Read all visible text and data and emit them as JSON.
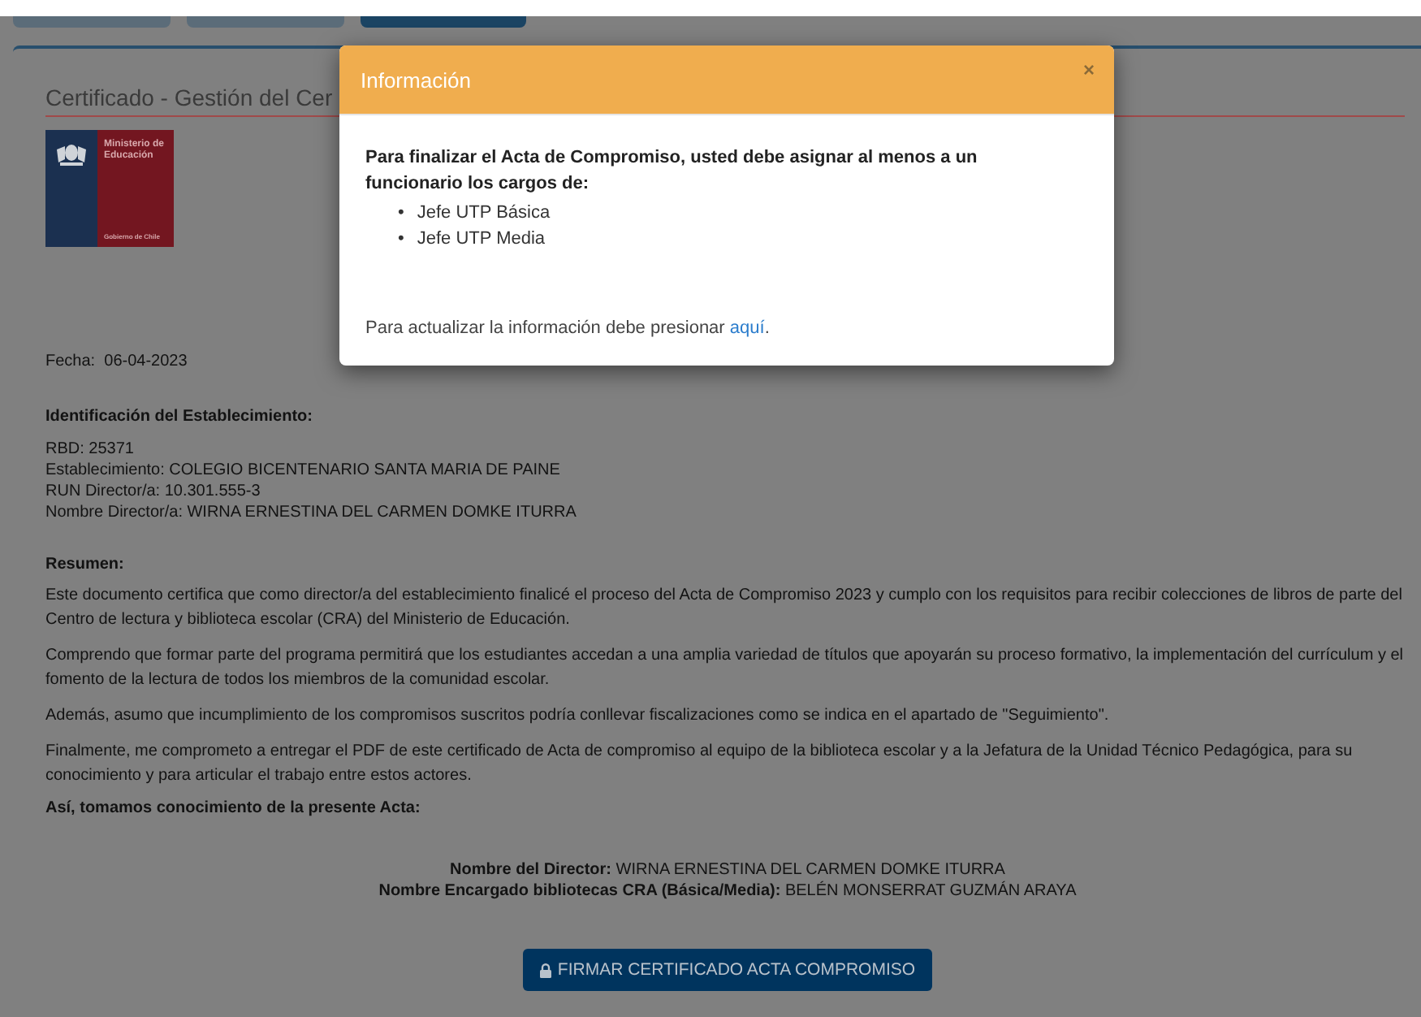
{
  "tabs": [
    {
      "selected": false
    },
    {
      "selected": false
    },
    {
      "selected": true
    }
  ],
  "page_title": "Certificado - Gestión del Cer",
  "logo": {
    "ministry": "Ministerio de Educación",
    "government": "Gobierno de Chile"
  },
  "date": "Fecha:  06-04-2023",
  "identification": {
    "heading": "Identificación del Establecimiento:",
    "lines": [
      "RBD: 25371",
      "Establecimiento: COLEGIO BICENTENARIO SANTA MARIA DE PAINE",
      "RUN Director/a: 10.301.555-3",
      "Nombre Director/a: WIRNA ERNESTINA DEL CARMEN DOMKE ITURRA"
    ]
  },
  "summary": {
    "heading": "Resumen:",
    "paragraphs": [
      "Este documento certifica que como director/a del establecimiento finalicé el proceso del Acta de Compromiso 2023 y cumplo con los requisitos para recibir colecciones de libros de parte del Centro de lectura y biblioteca escolar (CRA) del Ministerio de Educación.",
      "Comprendo que formar parte del programa permitirá que los estudiantes accedan a una amplia variedad de títulos que apoyarán su proceso formativo, la implementación del currículum y el fomento de la lectura de todos los miembros de la comunidad escolar.",
      "Además, asumo que incumplimiento de los compromisos suscritos podría conllevar fiscalizaciones como se indica en el apartado de \"Seguimiento\".",
      "Finalmente, me comprometo a entregar el PDF de este certificado de Acta de compromiso al equipo de la biblioteca escolar y a la Jefatura de la Unidad Técnico Pedagógica, para su conocimiento y para articular el trabajo entre estos actores."
    ],
    "closing": "Así, tomamos conocimiento de la presente Acta:"
  },
  "signatures": [
    "**Nombre del Director:** WIRNA ERNESTINA DEL CARMEN DOMKE ITURRA",
    "**Nombre Encargado bibliotecas CRA (Básica/Media):** BELÉN MONSERRAT GUZMÁN ARAYA"
  ],
  "sign_button": {
    "label": "FIRMAR CERTIFICADO ACTA COMPROMISO"
  },
  "modal": {
    "title": "Información",
    "close": "×",
    "message": "Para finalizar el Acta de Compromiso, usted debe asignar al menos a un funcionario los cargos de:",
    "items": [
      {
        "bullet": "•",
        "text": "Jefe UTP Básica"
      },
      {
        "bullet": "•",
        "text": "Jefe UTP Media"
      }
    ],
    "footer": "Para actualizar la información debe presionar ",
    "link": "aquí",
    "after_link": "."
  }
}
